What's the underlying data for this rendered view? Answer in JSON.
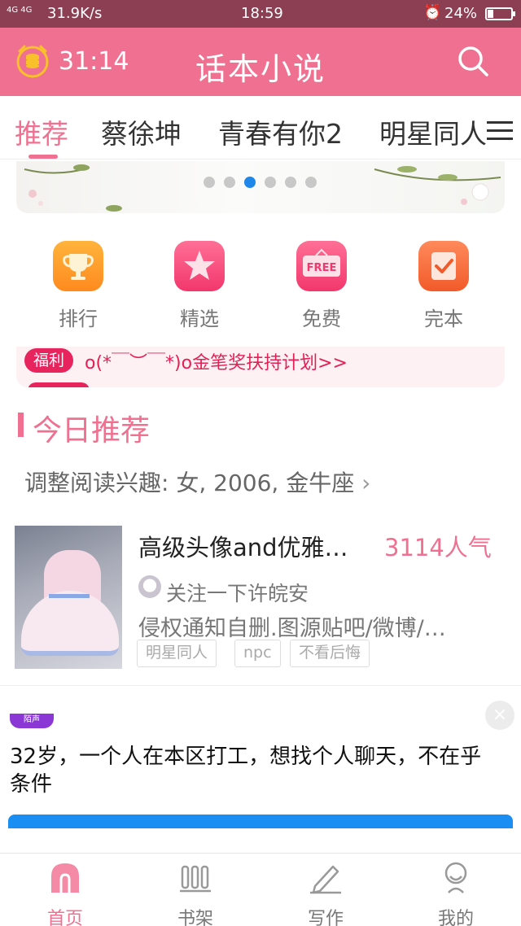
{
  "status_bar": {
    "network": "4G 4G",
    "speed": "31.9K/s",
    "time": "18:59",
    "battery": "24%",
    "battery_level": 0.24
  },
  "header": {
    "timer": "31:14",
    "title": "话本小说"
  },
  "tabs": [
    {
      "label": "推荐"
    },
    {
      "label": "蔡徐坤"
    },
    {
      "label": "青春有你2"
    },
    {
      "label": "明星同人"
    }
  ],
  "banner": {
    "slide_count": 6,
    "active_slide": 3
  },
  "quick_entries": [
    {
      "label": "排行"
    },
    {
      "label": "精选"
    },
    {
      "label": "免费",
      "icon_text": "FREE"
    },
    {
      "label": "完本"
    }
  ],
  "welfare": {
    "badge": "福利",
    "text": "o(*￣︶￣*)o金笔奖扶持计划>>"
  },
  "today": {
    "title": "今日推荐",
    "interest": "调整阅读兴趣: 女, 2006, 金牛座"
  },
  "book": {
    "title": "高级头像and优雅…",
    "popularity": "3114人气",
    "author": "关注一下许皖安",
    "description": "侵权通知自删.图源贴吧/微博/…",
    "tags": [
      "明星同人",
      "npc",
      "不看后悔"
    ]
  },
  "ad": {
    "logo_text": "陌声",
    "text": "32岁，一个人在本区打工，想找个人聊天，不在乎条件"
  },
  "bottom_nav": [
    {
      "label": "首页"
    },
    {
      "label": "书架"
    },
    {
      "label": "写作"
    },
    {
      "label": "我的"
    }
  ],
  "colors": {
    "primary": "#ef7090",
    "status_bar": "#8c3f52",
    "accent_red": "#e8245f",
    "ad_button": "#1a8ef3"
  }
}
